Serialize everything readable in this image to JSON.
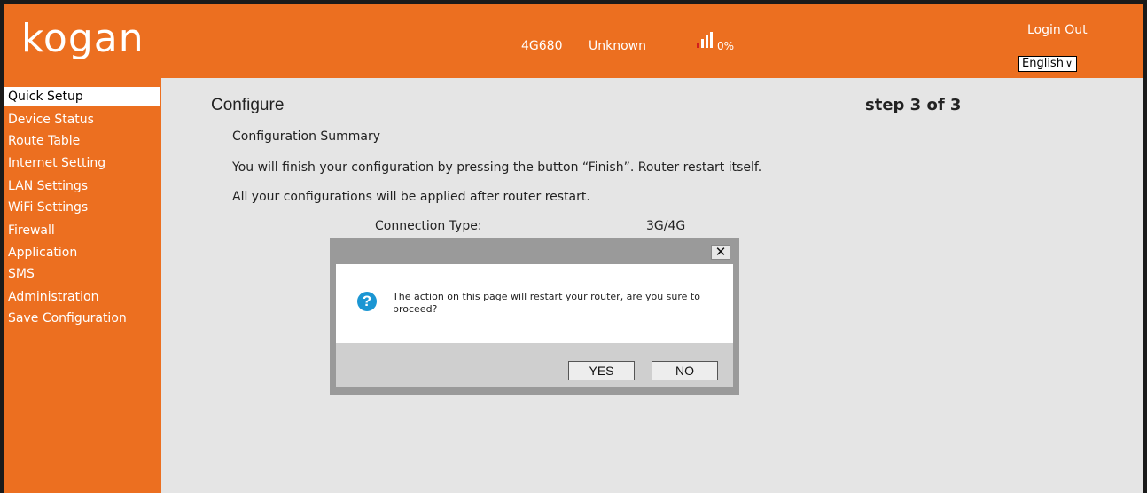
{
  "header": {
    "brand": "kogan",
    "model": "4G680",
    "network": "Unknown",
    "signal_percent": "0%",
    "signal_level": 0,
    "login_label": "Login Out",
    "language": "English"
  },
  "sidebar": {
    "items": [
      {
        "label": "Quick Setup",
        "active": true
      },
      {
        "label": "Device Status"
      },
      {
        "label": "Route Table"
      },
      {
        "label": "Internet Setting"
      },
      {
        "label": "LAN Settings"
      },
      {
        "label": "WiFi Settings"
      },
      {
        "label": "Firewall"
      },
      {
        "label": "Application"
      },
      {
        "label": "SMS"
      },
      {
        "label": "Administration"
      },
      {
        "label": "Save Configuration"
      }
    ]
  },
  "main": {
    "title": "Configure",
    "step": "step 3 of 3",
    "subtitle": "Configuration Summary",
    "line1": "You will finish your configuration by pressing the button “Finish”. Router restart itself.",
    "line2": "All your configurations will be applied after router restart.",
    "connection_type_label": "Connection Type:",
    "connection_type_value": "3G/4G"
  },
  "dialog": {
    "close_glyph": "✕",
    "icon_glyph": "?",
    "message": "The action on this page will restart your router, are you sure to proceed?",
    "yes_label": "YES",
    "no_label": "NO"
  },
  "colors": {
    "brand_orange": "#ec6f20",
    "content_bg": "#e5e5e5",
    "dialog_frame": "#9a9a9a",
    "question_icon": "#1b96d3",
    "signal_red": "#d21d1d"
  }
}
